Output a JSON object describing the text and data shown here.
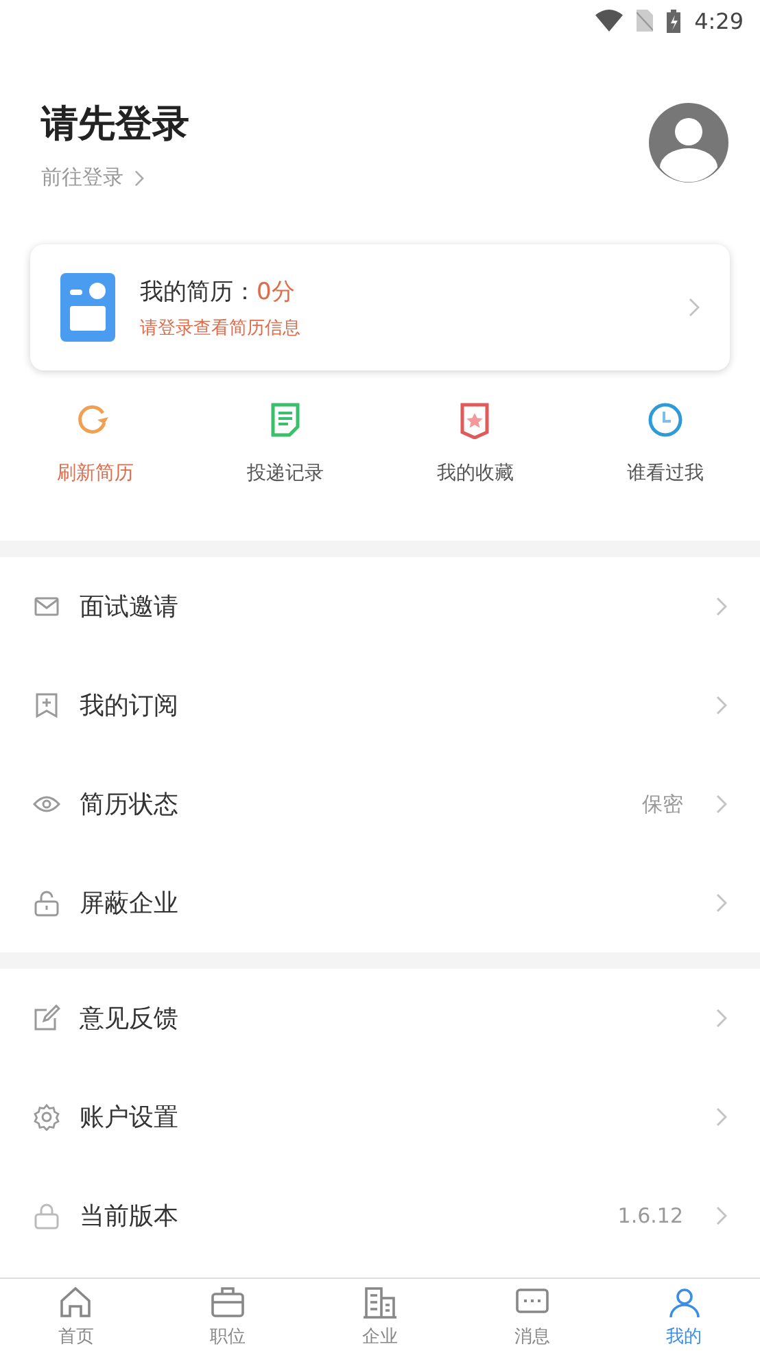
{
  "status_bar": {
    "time": "4:29"
  },
  "header": {
    "title": "请先登录",
    "login_link": "前往登录"
  },
  "resume_card": {
    "label": "我的简历：",
    "score": "0分",
    "hint": "请登录查看简历信息"
  },
  "quick_actions": [
    {
      "label": "刷新简历",
      "selected": true
    },
    {
      "label": "投递记录",
      "selected": false
    },
    {
      "label": "我的收藏",
      "selected": false
    },
    {
      "label": "谁看过我",
      "selected": false
    }
  ],
  "menu_sections": [
    [
      {
        "label": "面试邀请"
      },
      {
        "label": "我的订阅"
      },
      {
        "label": "简历状态",
        "value": "保密"
      },
      {
        "label": "屏蔽企业"
      }
    ],
    [
      {
        "label": "意见反馈"
      },
      {
        "label": "账户设置"
      },
      {
        "label": "当前版本",
        "value": "1.6.12"
      }
    ]
  ],
  "tab_bar": [
    {
      "label": "首页",
      "selected": false
    },
    {
      "label": "职位",
      "selected": false
    },
    {
      "label": "企业",
      "selected": false
    },
    {
      "label": "消息",
      "selected": false
    },
    {
      "label": "我的",
      "selected": true
    }
  ]
}
